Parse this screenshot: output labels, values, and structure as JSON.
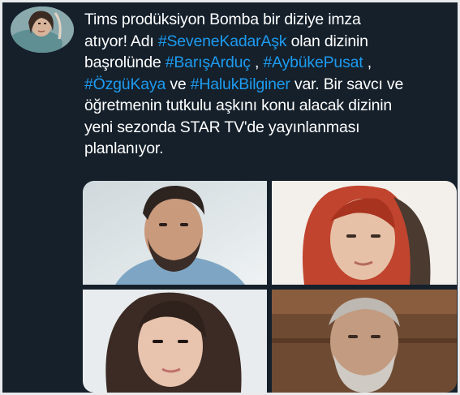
{
  "tweet": {
    "lines": [
      [
        {
          "t": "Tims prodüksiyon Bomba bir diziye imza"
        }
      ],
      [
        {
          "t": "atıyor! Adı "
        },
        {
          "t": "#SeveneKadarAşk",
          "tag": true
        },
        {
          "t": " olan dizinin"
        }
      ],
      [
        {
          "t": "başrolünde "
        },
        {
          "t": "#BarışArduç",
          "tag": true
        },
        {
          "t": " , "
        },
        {
          "t": "#AybükePusat",
          "tag": true
        },
        {
          "t": " ,"
        }
      ],
      [
        {
          "t": "#ÖzgüKaya",
          "tag": true
        },
        {
          "t": " ve "
        },
        {
          "t": "#HalukBilginer",
          "tag": true
        },
        {
          "t": " var. Bir savcı ve"
        }
      ],
      [
        {
          "t": "öğretmenin tutkulu aşkını konu alacak dizinin"
        }
      ],
      [
        {
          "t": "yeni sezonda STAR TV'de yayınlanması"
        }
      ],
      [
        {
          "t": "planlanıyor."
        }
      ]
    ]
  },
  "colors": {
    "background": "#15202b",
    "text": "#ffffff",
    "hashtag": "#1d9bf0",
    "border": "#e9eaec"
  },
  "media": {
    "count": 4,
    "photos": [
      "photo-man-beard",
      "photo-woman-red-hair",
      "photo-woman-dark-hair",
      "photo-older-man-gray-beard"
    ]
  }
}
